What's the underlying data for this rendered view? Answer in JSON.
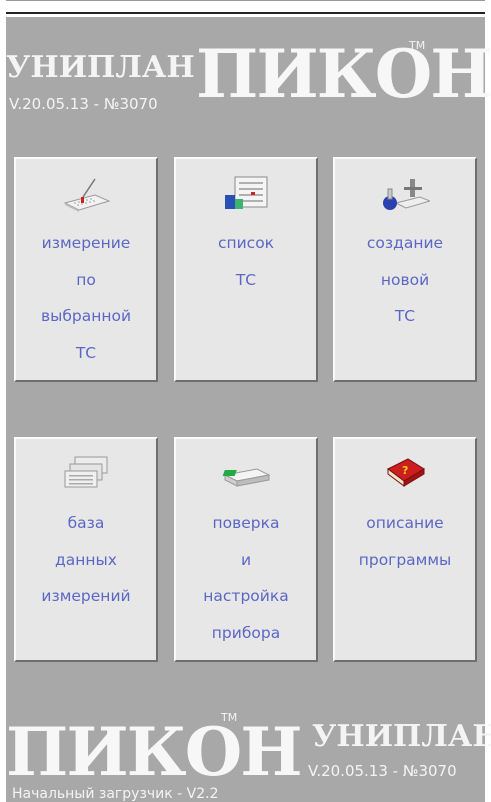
{
  "header": {
    "brand_small": "УНИПЛАН",
    "brand_big": "ПИКОН",
    "tm": "TM",
    "version": "V.20.05.13 - №3070"
  },
  "tiles": [
    {
      "icon": "measurement-icon",
      "lines": [
        "измерение",
        "по",
        "выбранной",
        "ТС"
      ]
    },
    {
      "icon": "list-icon",
      "lines": [
        "список",
        "ТС"
      ]
    },
    {
      "icon": "create-new-icon",
      "lines": [
        "создание",
        "новой",
        "ТС"
      ]
    },
    {
      "icon": "database-icon",
      "lines": [
        "база",
        "данных",
        "измерений"
      ]
    },
    {
      "icon": "device-calibration-icon",
      "lines": [
        "поверка",
        "и",
        "настройка",
        "прибора"
      ]
    },
    {
      "icon": "help-book-icon",
      "lines": [
        "описание",
        "программы"
      ]
    }
  ],
  "footer_brand": {
    "brand_big": "ПИКОН",
    "tm": "TM",
    "brand_small": "УНИПЛАН",
    "version": "V.20.05.13 - №3070"
  },
  "status": "Начальный загрузчик - V2.2",
  "colors": {
    "background": "#a8a8a8",
    "tile": "#e7e7e7",
    "label": "#5b67c4"
  }
}
